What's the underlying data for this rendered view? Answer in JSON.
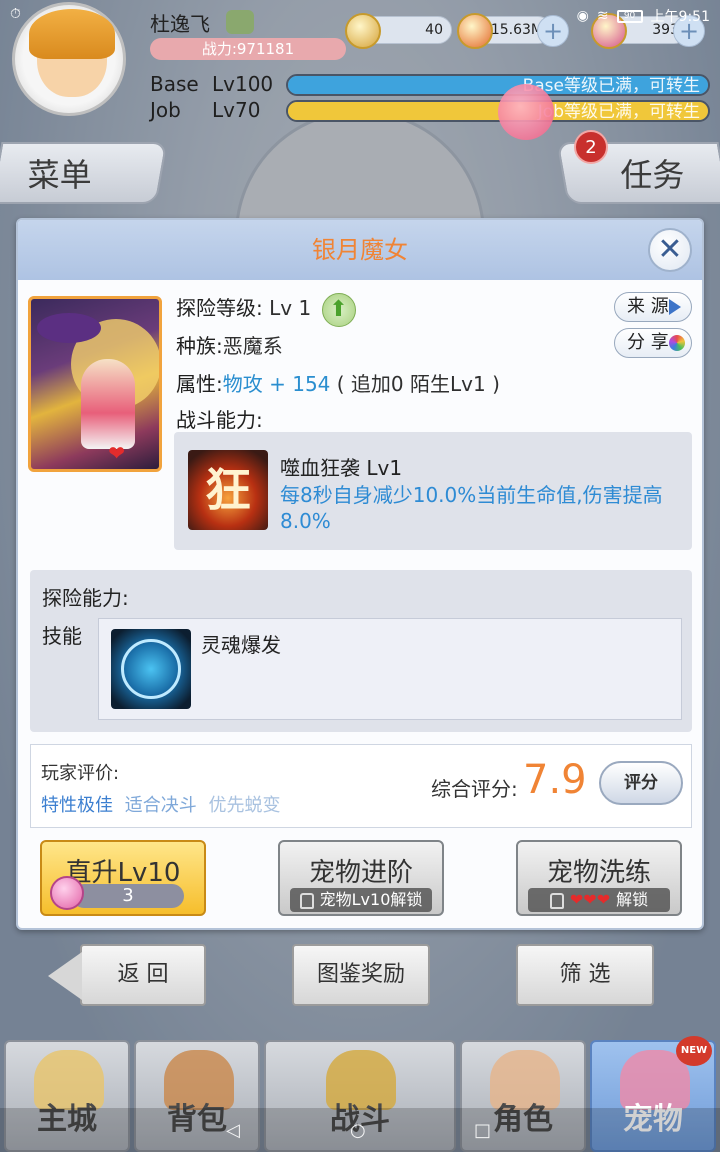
{
  "status_bar": {
    "time": "上午9:51",
    "battery": "90"
  },
  "player": {
    "name": "杜逸飞",
    "power": "战力:971181",
    "currencies": [
      {
        "name": "zeny",
        "value": "40",
        "color": "#d5a33a"
      },
      {
        "name": "gold-coin",
        "value": "15.63M",
        "color": "#e36a2c"
      },
      {
        "name": "gem",
        "value": "393",
        "color": "#d4528a"
      }
    ],
    "base_label": "Base",
    "base_level": "Lv100",
    "base_status": "Base等级已满，可转生",
    "job_label": "Job",
    "job_level": "Lv70",
    "job_status": "Job等级已满，可转生",
    "base_bar_color": "#3ea3dd",
    "job_bar_color": "#f0c73a"
  },
  "tabs": {
    "menu": "菜单",
    "task": "任务",
    "task_badge": "2"
  },
  "dialog": {
    "title": "银月魔女",
    "close_icon": "close-icon",
    "adventure_level_key": "探险等级:",
    "adventure_level_val": "Lv 1",
    "race_key": "种族:",
    "race_val": "恶魔系",
    "attr_key": "属性:",
    "attr_val": "物攻 + 154",
    "attr_extra": "( 追加0 陌生Lv1 )",
    "battle_ability_label": "战斗能力:",
    "source_button": "来 源",
    "share_button": "分 享",
    "battle_skill": {
      "icon_glyph": "狂",
      "name": "噬血狂袭 Lv1",
      "desc": "每8秒自身减少10.0%当前生命值,伤害提高8.0%"
    },
    "explore": {
      "title": "探险能力:",
      "skill_label": "技能",
      "skill_name": "灵魂爆发"
    },
    "rating": {
      "title": "玩家评价:",
      "tags": [
        {
          "text": "特性极佳",
          "color": "#3c7fd0"
        },
        {
          "text": "适合决斗",
          "color": "#7fa8d9"
        },
        {
          "text": "优先蜕变",
          "color": "#a9c2e0"
        }
      ],
      "score_label": "综合评分:",
      "score_value": "7.9",
      "rate_button": "评分"
    },
    "actions": {
      "levelup_label": "直升Lv10",
      "levelup_cost": "3",
      "advance_label": "宠物进阶",
      "advance_lock": "宠物Lv10解锁",
      "refine_label": "宠物洗练",
      "refine_lock": "解锁",
      "refine_hearts": "❤❤❤"
    }
  },
  "lower_buttons": {
    "back": "返 回",
    "handbook_reward": "图鉴奖励",
    "filter": "筛 选"
  },
  "bottom_nav": [
    {
      "label": "主城",
      "name": "nav-main-city",
      "art_color": "#e8c46a"
    },
    {
      "label": "背包",
      "name": "nav-bag",
      "art_color": "#c9874a"
    },
    {
      "label": "战斗",
      "name": "nav-battle",
      "art_color": "#d4a93c"
    },
    {
      "label": "角色",
      "name": "nav-character",
      "art_color": "#e6b48a"
    },
    {
      "label": "宠物",
      "name": "nav-pet",
      "art_color": "#f08aa8"
    }
  ],
  "new_badge": "NEW"
}
